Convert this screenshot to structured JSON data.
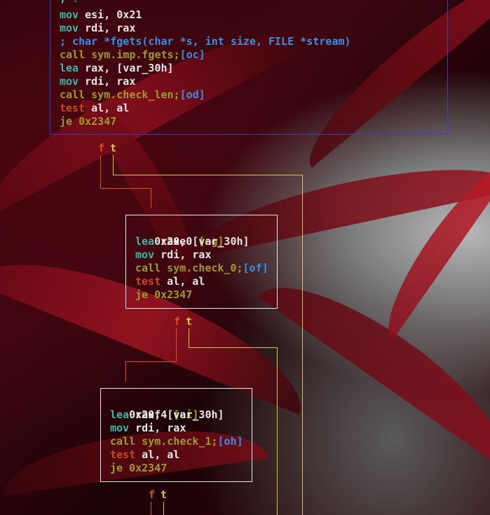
{
  "colors": {
    "mnemonic_mov_lea": "#3fb8a6",
    "mnemonic_call_je": "#9f9a2c",
    "mnemonic_test": "#d0461c",
    "operand": "#e8e8e8",
    "comment_ref": "#3d8ee8",
    "edge_false": "#d84f22",
    "edge_true": "#d5c34a",
    "block_border_first": "#3a3fd0",
    "block_border": "#e8e8e8"
  },
  "block_top": {
    "clipped_line": "; !",
    "lines": [
      {
        "op": "mov",
        "args": " esi, 0x21",
        "ref": ""
      },
      {
        "op": "mov",
        "args": " rdi, rax",
        "ref": ""
      },
      {
        "comment": "; char *fgets(char *s, int size, FILE *stream)"
      },
      {
        "op": "call",
        "args": " sym.imp.fgets;",
        "ref": "[oc]"
      },
      {
        "op": "lea",
        "args": " rax, [var_30h]",
        "ref": ""
      },
      {
        "op": "mov",
        "args": " rdi, rax",
        "ref": ""
      },
      {
        "op": "call",
        "args": " sym.check_len;",
        "ref": "[od]"
      },
      {
        "op": "test",
        "args": " al, al",
        "ref": ""
      },
      {
        "op": "je",
        "args": " 0x2347",
        "ref": ""
      }
    ]
  },
  "block_2": {
    "addr": "0x20e0",
    "tag": "[og]",
    "lines": [
      {
        "op": "lea",
        "args": " rax, [var_30h]",
        "ref": ""
      },
      {
        "op": "mov",
        "args": " rdi, rax",
        "ref": ""
      },
      {
        "op": "call",
        "args": " sym.check_0;",
        "ref": "[of]"
      },
      {
        "op": "test",
        "args": " al, al",
        "ref": ""
      },
      {
        "op": "je",
        "args": " 0x2347",
        "ref": ""
      }
    ]
  },
  "block_3": {
    "addr": "0x20f4",
    "tag": "[oi]",
    "lines": [
      {
        "op": "lea",
        "args": " rax, [var_30h]",
        "ref": ""
      },
      {
        "op": "mov",
        "args": " rdi, rax",
        "ref": ""
      },
      {
        "op": "call",
        "args": " sym.check_1;",
        "ref": "[oh]"
      },
      {
        "op": "test",
        "args": " al, al",
        "ref": ""
      },
      {
        "op": "je",
        "args": " 0x2347",
        "ref": ""
      }
    ]
  },
  "edge_labels": {
    "false": "f",
    "true": "t"
  }
}
